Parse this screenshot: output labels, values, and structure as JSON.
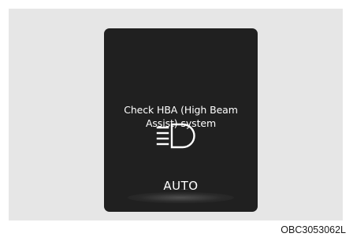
{
  "warning": {
    "message_line1": "Check HBA (High Beam",
    "message_line2": "Assist) system",
    "mode_label": "AUTO",
    "icon": "auto-high-beam-icon"
  },
  "figure_code": "OBC3053062L",
  "colors": {
    "background": "#e6e6e6",
    "display": "#202020",
    "text": "#ffffff"
  }
}
